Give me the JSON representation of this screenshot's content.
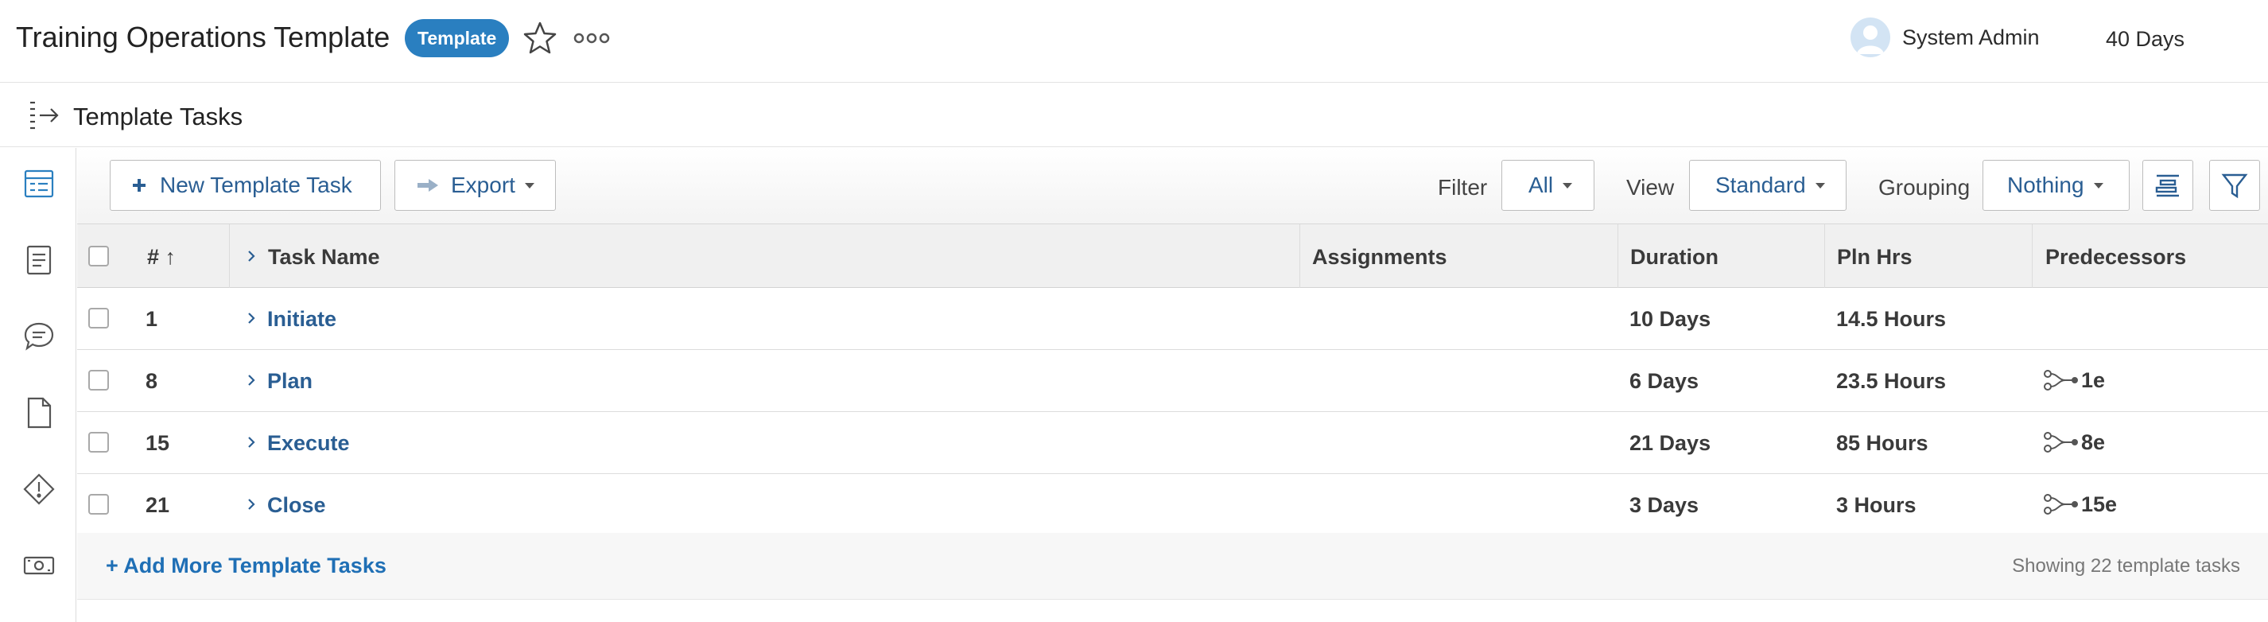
{
  "header": {
    "title": "Training Operations Template",
    "badge": "Template",
    "user_name": "System Admin",
    "duration": "40 Days"
  },
  "section": {
    "title": "Template Tasks"
  },
  "rail": {
    "items": [
      "tasks-icon",
      "details-icon",
      "updates-icon",
      "documents-icon",
      "issues-icon",
      "finance-icon"
    ]
  },
  "toolbar": {
    "new_task_label": "New Template Task",
    "export_label": "Export",
    "filter_label": "Filter",
    "filter_value": "All",
    "view_label": "View",
    "view_value": "Standard",
    "grouping_label": "Grouping",
    "grouping_value": "Nothing"
  },
  "table": {
    "columns": {
      "number": "# ↑",
      "task_name": "Task Name",
      "assignments": "Assignments",
      "duration": "Duration",
      "planned_hours": "Pln Hrs",
      "predecessors": "Predecessors"
    },
    "rows": [
      {
        "number": "1",
        "name": "Initiate",
        "assignments": "",
        "duration": "10 Days",
        "planned_hours": "14.5 Hours",
        "predecessors": ""
      },
      {
        "number": "8",
        "name": "Plan",
        "assignments": "",
        "duration": "6 Days",
        "planned_hours": "23.5 Hours",
        "predecessors": "1e"
      },
      {
        "number": "15",
        "name": "Execute",
        "assignments": "",
        "duration": "21 Days",
        "planned_hours": "85 Hours",
        "predecessors": "8e"
      },
      {
        "number": "21",
        "name": "Close",
        "assignments": "",
        "duration": "3 Days",
        "planned_hours": "3 Hours",
        "predecessors": "15e"
      }
    ]
  },
  "footer": {
    "add_more": "+ Add More Template Tasks",
    "showing": "Showing 22 template tasks"
  },
  "colors": {
    "accent": "#2a7fc0",
    "link": "#2a5e93",
    "badge_bg": "#2a7fc0"
  }
}
